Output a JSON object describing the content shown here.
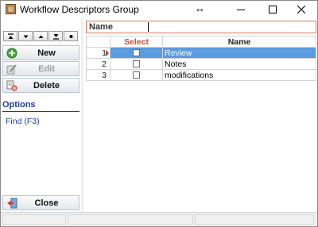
{
  "window": {
    "title": "Workflow Descriptors Group",
    "resize_glyph": "↔",
    "icons": {
      "app": "workflow-app-icon",
      "minimize": "minimize-icon",
      "maximize": "maximize-icon",
      "close": "close-icon"
    }
  },
  "navigator": {
    "buttons": [
      {
        "icon": "first-record-icon"
      },
      {
        "icon": "scroll-down-icon"
      },
      {
        "icon": "scroll-up-icon"
      },
      {
        "icon": "last-record-icon"
      },
      {
        "icon": "dot-icon"
      }
    ]
  },
  "actions": {
    "new_label": "New",
    "edit_label": "Edit",
    "delete_label": "Delete",
    "close_label": "Close",
    "edit_enabled": false
  },
  "options": {
    "title": "Options",
    "find_label": "Find  (F3)"
  },
  "filter": {
    "name_label": "Name",
    "name_value": ""
  },
  "grid": {
    "columns": {
      "select": "Select",
      "name": "Name"
    },
    "rows": [
      {
        "num": "1",
        "name": "Review",
        "selected": true,
        "checked": false
      },
      {
        "num": "2",
        "name": "Notes",
        "selected": false,
        "checked": false
      },
      {
        "num": "3",
        "name": "modifications",
        "selected": false,
        "checked": false
      }
    ]
  },
  "colors": {
    "selection": "#5b9be0",
    "select_header": "#d24a2a",
    "options_title": "#1f3d8f",
    "link": "#1c45a8"
  }
}
